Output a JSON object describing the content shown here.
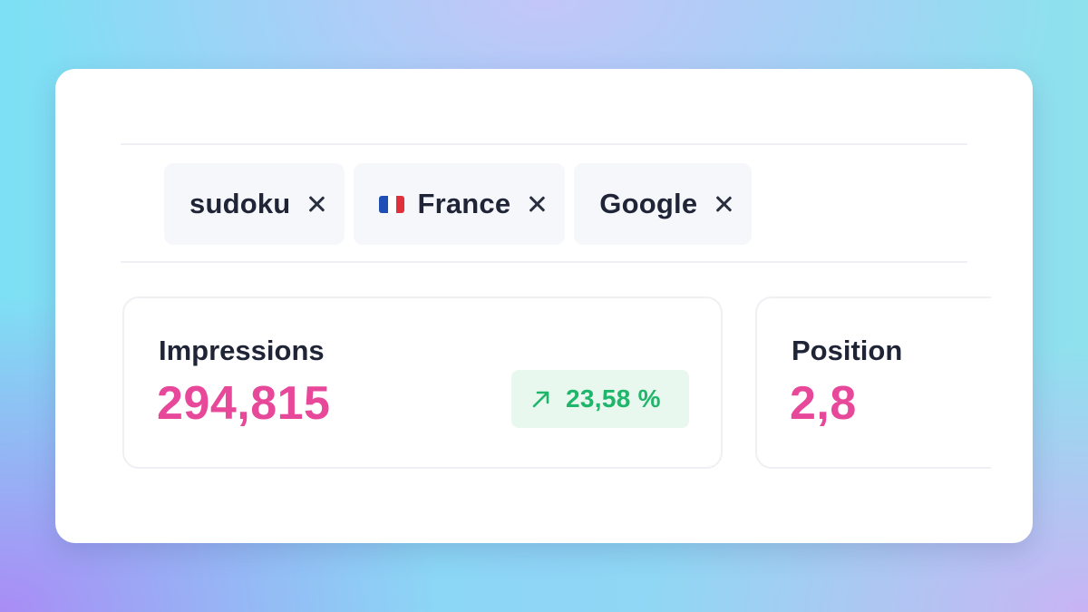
{
  "filters": [
    {
      "label": "sudoku",
      "has_flag": false
    },
    {
      "label": "France",
      "has_flag": true,
      "flag": "france-flag-icon"
    },
    {
      "label": "Google",
      "has_flag": false
    }
  ],
  "metrics": [
    {
      "label": "Impressions",
      "value": "294,815",
      "change": "23,58 %",
      "trend": "up"
    },
    {
      "label": "Position",
      "value": "2,8"
    }
  ],
  "colors": {
    "accent_value": "#e8489a",
    "trend_up": "#1fb56a",
    "trend_up_bg": "#e9f8ef",
    "chip_bg": "#f5f7fa",
    "text_dark": "#1f2436"
  }
}
